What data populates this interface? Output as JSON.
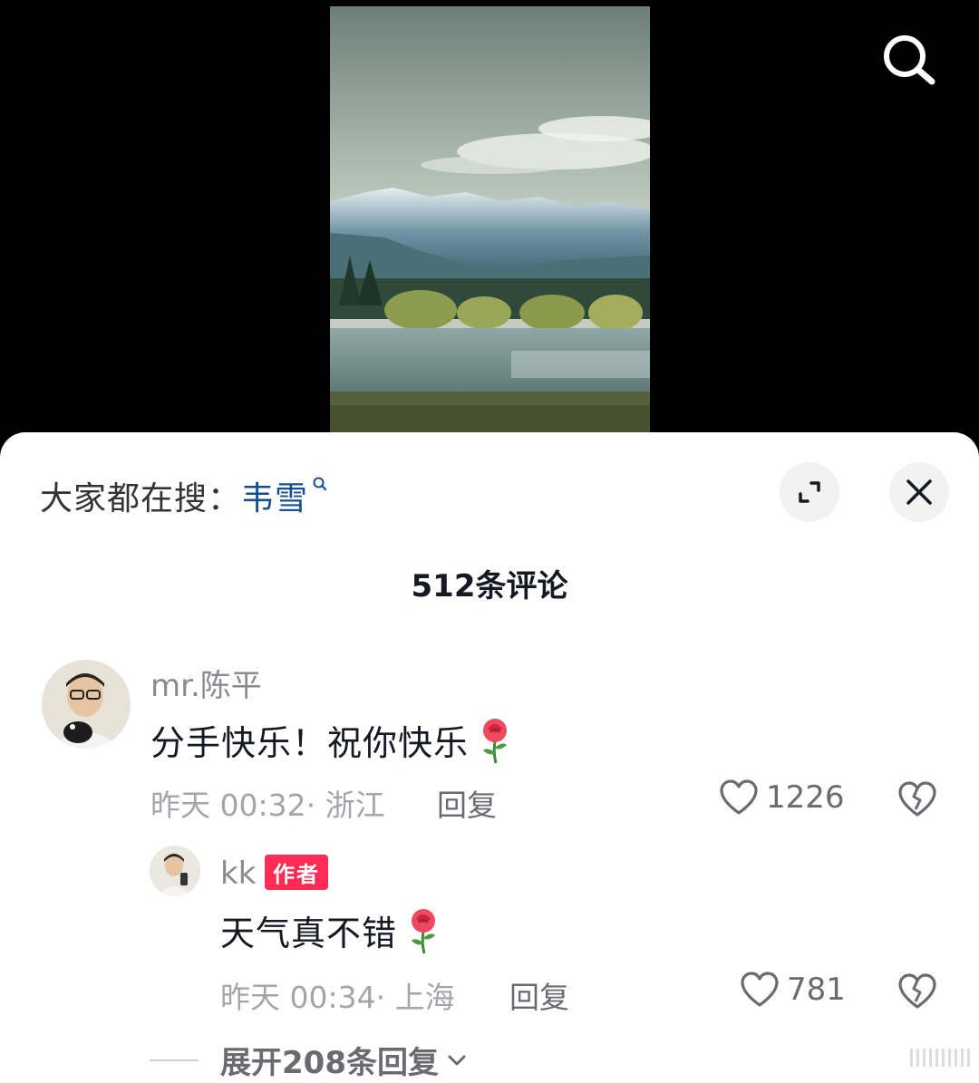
{
  "trending": {
    "label": "大家都在搜：",
    "keyword": "韦雪"
  },
  "comments_header": {
    "count_label": "512条评论"
  },
  "comments": [
    {
      "username": "mr.陈平",
      "text": "分手快乐！祝你快乐",
      "meta": "昨天 00:32· 浙江",
      "reply_label": "回复",
      "likes": "1226",
      "replies": [
        {
          "username": "kk",
          "badge": "作者",
          "text": "天气真不错",
          "meta": "昨天 00:34· 上海",
          "reply_label": "回复",
          "likes": "781"
        }
      ],
      "expand_label": "展开208条回复"
    }
  ],
  "icons": {
    "search": "search-icon",
    "expand": "expand-icon",
    "close": "close-icon",
    "like": "heart-outline-icon",
    "dislike": "broken-heart-icon",
    "rose": "rose-emoji-icon",
    "chevron": "chevron-down-icon"
  },
  "colors": {
    "accent_link": "#14508f",
    "author_badge": "#fe2c55",
    "sheet_bg": "#ffffff",
    "video_bg": "#000000"
  }
}
